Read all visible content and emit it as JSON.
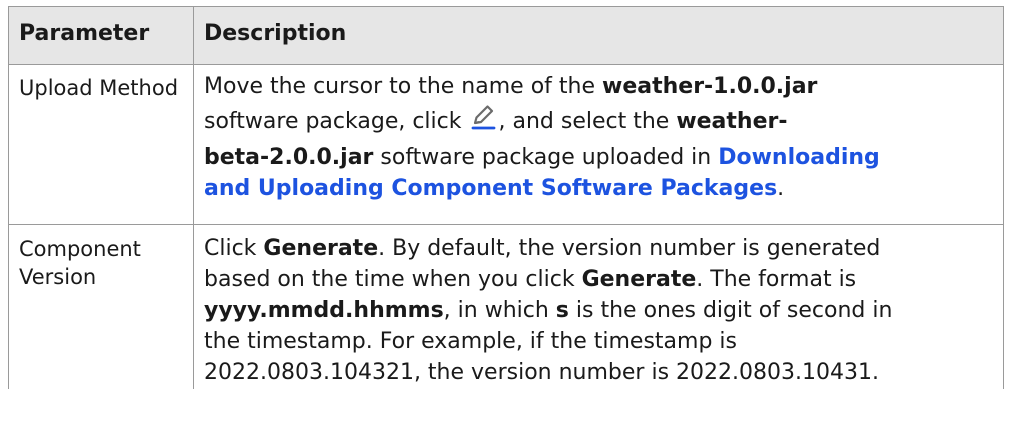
{
  "table": {
    "headers": [
      "Parameter",
      "Description"
    ],
    "rows": [
      {
        "param": "Upload Method",
        "desc": {
          "l1a": "Move the cursor to the name of the ",
          "l1b": "weather-1.0.0.jar",
          "l2a": "software package, click ",
          "l2b": ", and select the ",
          "l2c": "weather-",
          "l3a": "beta-2.0.0.jar",
          "l3b": " software package uploaded in ",
          "l3c": "Downloading",
          "l4a": "and Uploading Component Software Packages",
          "l4b": "."
        }
      },
      {
        "param": "Component Version",
        "desc": {
          "l1a": "Click ",
          "l1b": "Generate",
          "l1c": ". By default, the version number is generated",
          "l2a": "based on the time when you click ",
          "l2b": "Generate",
          "l2c": ". The format is",
          "l3a": "yyyy.mmdd.hhmms",
          "l3b": ", in which ",
          "l3c": "s",
          "l3d": " is the ones digit of second in",
          "l4": "the timestamp. For example, if the timestamp is",
          "l5": "2022.0803.104321, the version number is 2022.0803.10431."
        }
      }
    ]
  },
  "icons": {
    "edit": "edit-pencil-icon",
    "edit_color": "#6b6b6b",
    "edit_underline_color": "#1d53e0"
  },
  "colors": {
    "link": "#1d53e0",
    "header_bg": "#e6e6e6",
    "border": "#9a9a9a"
  }
}
